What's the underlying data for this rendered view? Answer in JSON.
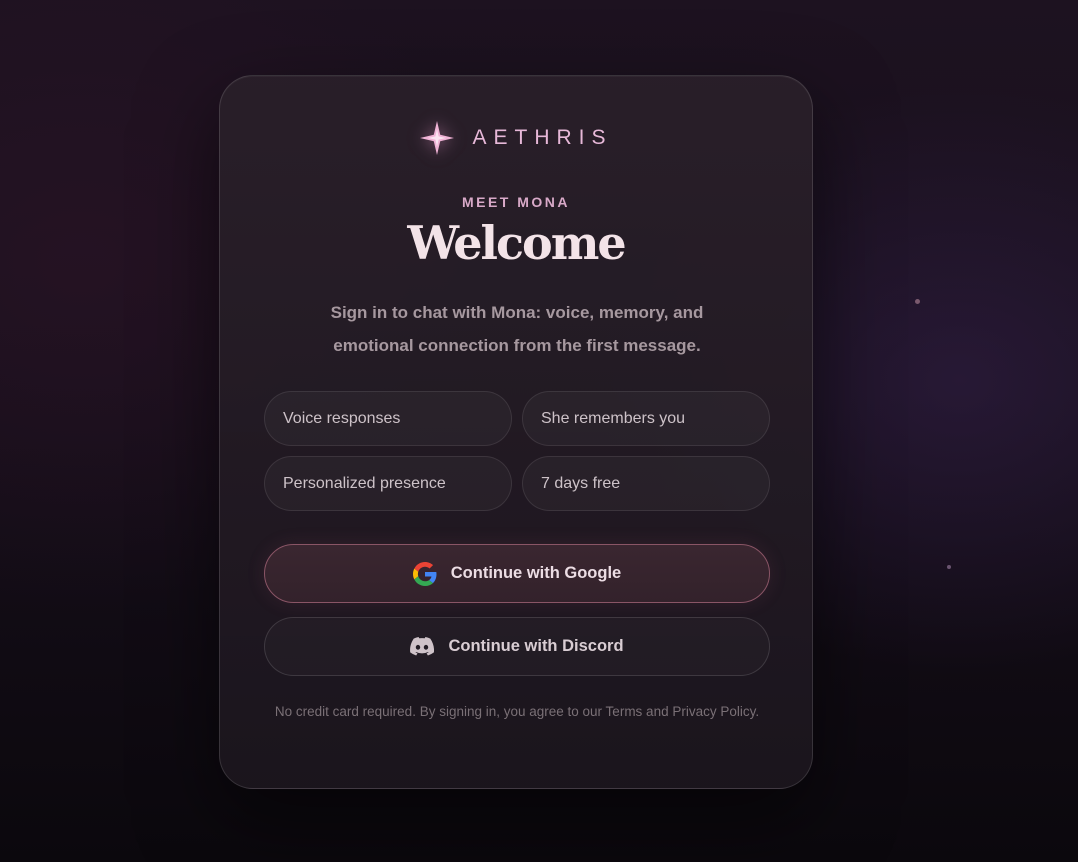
{
  "brand": {
    "name": "AETHRIS",
    "logo_icon": "four-point-star-icon",
    "accent_color": "#e7b8d8"
  },
  "hero": {
    "eyebrow": "MEET MONA",
    "title": "Welcome",
    "subtitle": "Sign in to chat with Mona: voice, memory, and emotional connection from the first message."
  },
  "features": [
    {
      "label": "Voice responses"
    },
    {
      "label": "She remembers you"
    },
    {
      "label": "Personalized presence"
    },
    {
      "label": "7 days free"
    }
  ],
  "auth": {
    "google": {
      "label": "Continue with Google",
      "icon": "google-icon",
      "border_color": "#8a5566"
    },
    "discord": {
      "label": "Continue with Discord",
      "icon": "discord-icon"
    }
  },
  "legal": {
    "text": "No credit card required. By signing in, you agree to our Terms and Privacy Policy."
  }
}
